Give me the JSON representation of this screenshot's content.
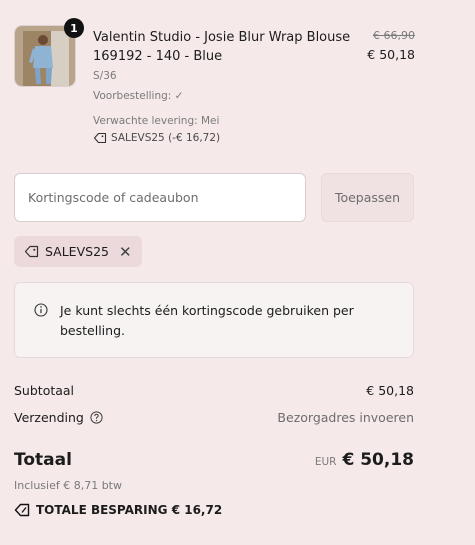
{
  "product": {
    "quantity": "1",
    "name": "Valentin Studio - Josie Blur Wrap Blouse 169192 - 140 - Blue",
    "size": "S/36",
    "preorder": "Voorbestelling: ✓",
    "delivery": "Verwachte levering: Mei",
    "applied_code": "SALEVS25 (-€ 16,72)",
    "old_price": "€ 66,90",
    "new_price": "€ 50,18",
    "image_icon": "product-photo"
  },
  "discount": {
    "placeholder": "Kortingscode of cadeaubon",
    "value": "",
    "apply_label": "Toepassen",
    "chip_label": "SALEVS25",
    "chip_close": "✕"
  },
  "notice": {
    "text": "Je kunt slechts één kortingscode gebruiken per bestelling."
  },
  "summary": {
    "subtotal_label": "Subtotaal",
    "subtotal_value": "€ 50,18",
    "shipping_label": "Verzending",
    "shipping_value": "Bezorgadres invoeren",
    "total_label": "Totaal",
    "currency": "EUR",
    "total_value": "€ 50,18",
    "tax_note": "Inclusief € 8,71 btw",
    "savings": "TOTALE BESPARING € 16,72"
  },
  "colors": {
    "background": "#f5e9ea",
    "chip": "#ecd9db",
    "badge": "#111111"
  }
}
